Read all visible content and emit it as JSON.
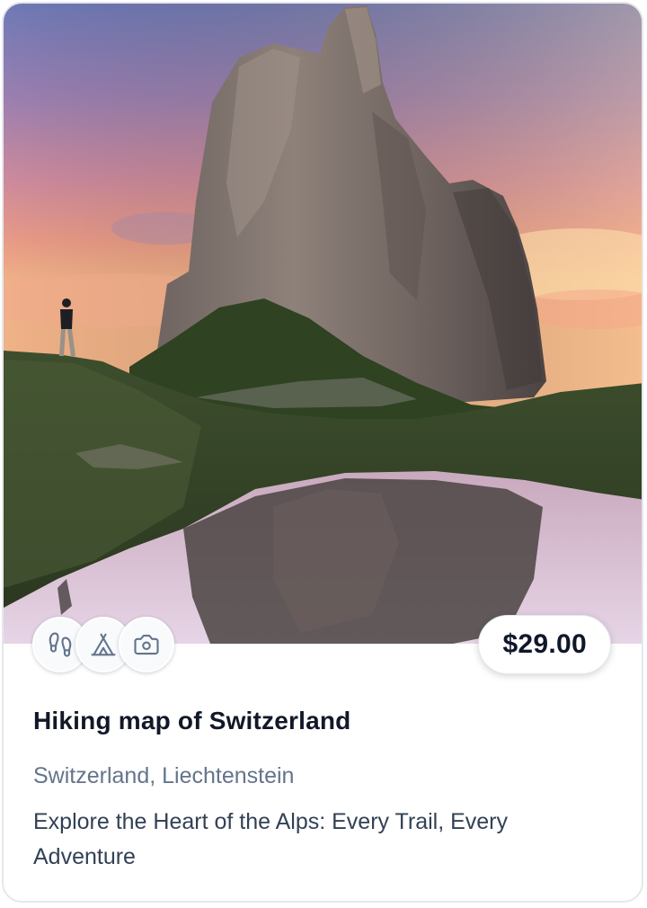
{
  "card": {
    "image_description_icon": "mountain-photo",
    "amenities": [
      {
        "icon": "footprints-icon"
      },
      {
        "icon": "tent-icon"
      },
      {
        "icon": "camera-icon"
      }
    ],
    "price": "$29.00",
    "title": "Hiking map of Switzerland",
    "location": "Switzerland, Liechtenstein",
    "description": "Explore the Heart of the Alps: Every Trail, Every Adventure"
  },
  "colors": {
    "title": "#111827",
    "location": "#64748b",
    "description": "#334155",
    "icon_stroke": "#64748b",
    "border": "#e5e7eb"
  }
}
